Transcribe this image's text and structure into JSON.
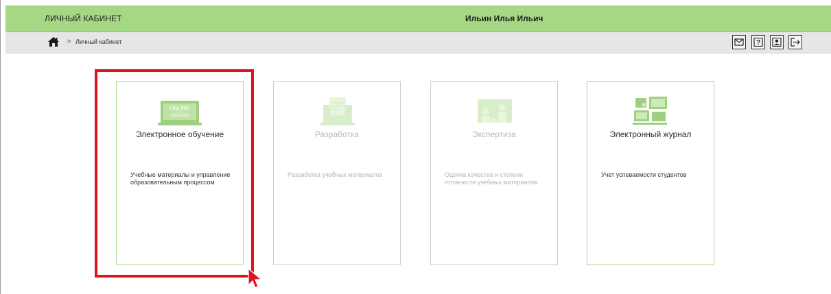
{
  "header": {
    "cabinet_title": "ЛИЧНЫЙ КАБИНЕТ",
    "user_name": "Ильин Илья Ильич"
  },
  "breadcrumb": {
    "separator": ">",
    "current": "Личный кабинет"
  },
  "toolbar": {
    "icons": [
      "mail-icon",
      "help-icon",
      "profile-icon",
      "logout-icon"
    ]
  },
  "cards": [
    {
      "title": "Электронное обучение",
      "desc": "Учебные материалы и управление образовательным процессом",
      "icon": "online-laptop-icon",
      "active": true,
      "badge_top": "ONLINE",
      "badge_bottom": "ÔÔÔÔÔ"
    },
    {
      "title": "Разработка",
      "desc": "Разработка учебных материалов",
      "icon": "laptop-document-icon",
      "active": false
    },
    {
      "title": "Экспертиза",
      "desc": "Оценка качества и степени готовности учебных материалов",
      "icon": "experts-screen-icon",
      "active": false
    },
    {
      "title": "Электронный журнал",
      "desc": "Учет успеваемости студентов",
      "icon": "devices-journal-icon",
      "active": true
    }
  ],
  "colors": {
    "header_green": "#a6d785",
    "card_border_active": "#a8d88a",
    "card_border_inactive": "#cdcdcd",
    "highlight_red": "#e0141e"
  }
}
